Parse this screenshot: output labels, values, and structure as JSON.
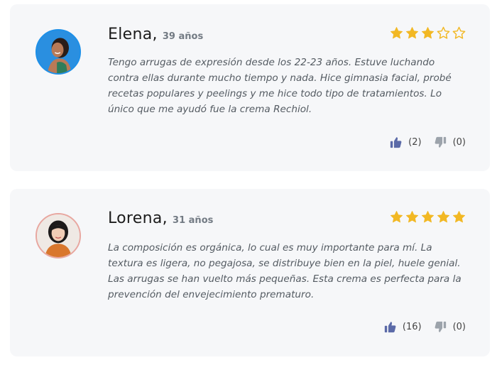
{
  "reviews": [
    {
      "name": "Elena",
      "age": "39 años",
      "rating": 3,
      "max_rating": 5,
      "text": "Tengo arrugas de expresión desde los 22-23 años. Estuve luchando contra ellas durante mucho tiempo y nada. Hice gimnasia facial, probé recetas populares y peelings y me hice todo tipo de tratamientos. Lo único que me ayudó fue la crema Rechiol.",
      "likes": "(2)",
      "dislikes": "(0)"
    },
    {
      "name": "Lorena",
      "age": "31 años",
      "rating": 5,
      "max_rating": 5,
      "text": "La composición es orgánica, lo cual es muy importante para mí. La textura es ligera, no pegajosa, se distribuye bien en la piel, huele genial. Las arrugas se han vuelto más pequeñas. Esta crema es perfecta para la prevención del envejecimiento prematuro.",
      "likes": "(16)",
      "dislikes": "(0)"
    }
  ],
  "colors": {
    "star": "#f2b824",
    "thumb_up": "#5b6aa8",
    "thumb_down": "#9ca3ab",
    "card_bg": "#f6f7f9"
  },
  "icons": {
    "star_full": "star-icon",
    "star_empty": "star-outline-icon",
    "like": "thumbs-up-icon",
    "dislike": "thumbs-down-icon"
  }
}
